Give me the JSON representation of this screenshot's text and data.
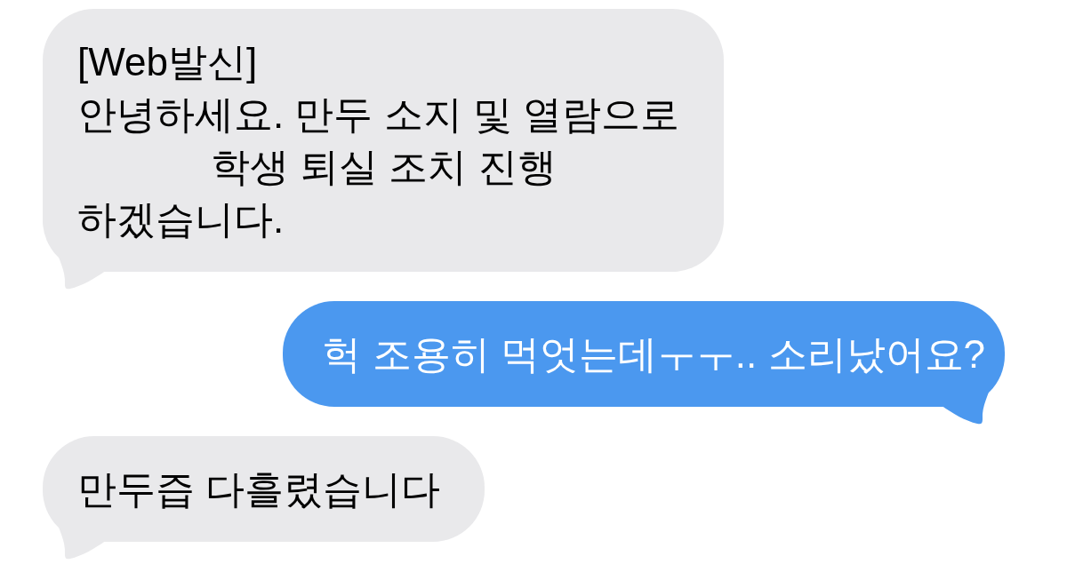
{
  "messages": [
    {
      "kind": "received",
      "lines": [
        {
          "text": "[Web발신]",
          "indented": false
        },
        {
          "text": "안녕하세요. 만두 소지 및 열람으로",
          "indented": false
        },
        {
          "text": "학생 퇴실 조치 진행",
          "indented": true
        },
        {
          "text": "하겠습니다.",
          "indented": false
        }
      ]
    },
    {
      "kind": "sent",
      "lines": [
        {
          "text": "헉 조용히 먹엇는데ㅜㅜ.. 소리났어요?",
          "indented": false
        }
      ]
    },
    {
      "kind": "received",
      "lines": [
        {
          "text": "만두즙 다흘렸습니다",
          "indented": false
        }
      ]
    }
  ]
}
